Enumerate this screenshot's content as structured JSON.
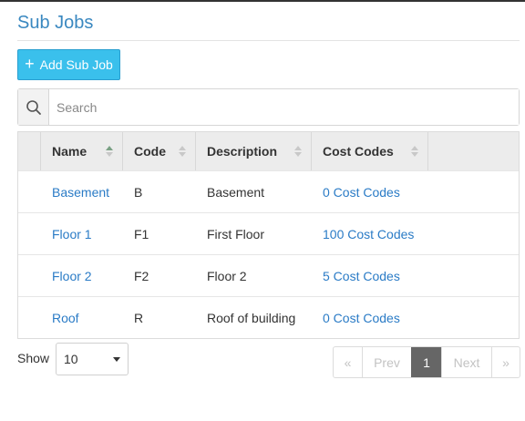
{
  "page_title": "Sub Jobs",
  "toolbar": {
    "add_label": "Add Sub Job"
  },
  "search": {
    "placeholder": "Search",
    "value": ""
  },
  "table": {
    "columns": [
      "Name",
      "Code",
      "Description",
      "Cost Codes"
    ],
    "rows": [
      {
        "name": "Basement",
        "code": "B",
        "description": "Basement",
        "cost_codes": "0 Cost Codes"
      },
      {
        "name": "Floor 1",
        "code": "F1",
        "description": "First Floor",
        "cost_codes": "100 Cost Codes"
      },
      {
        "name": "Floor 2",
        "code": "F2",
        "description": "Floor 2",
        "cost_codes": "5 Cost Codes"
      },
      {
        "name": "Roof",
        "code": "R",
        "description": "Roof of building",
        "cost_codes": "0 Cost Codes"
      }
    ],
    "sorted_column": "Name",
    "sort_direction": "ascending"
  },
  "footer": {
    "show_label": "Show",
    "page_size": "10",
    "pagination": {
      "first": "«",
      "prev": "Prev",
      "current": "1",
      "next": "Next",
      "last": "»"
    }
  },
  "colors": {
    "accent": "#3ac0ec",
    "title": "#3a88c0",
    "link": "#2a7bc6",
    "current_page": "#666666"
  }
}
